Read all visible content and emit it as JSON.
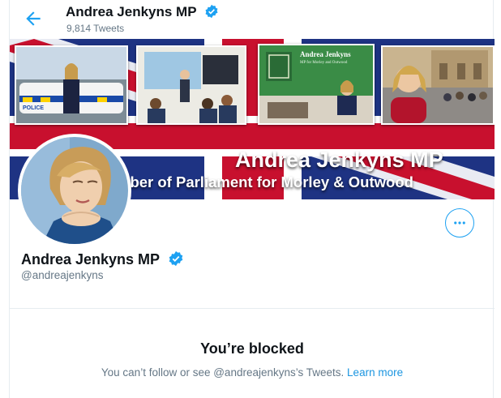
{
  "header": {
    "name": "Andrea Jenkyns MP",
    "tweet_count": "9,814 Tweets",
    "back_icon": "arrow-left-icon"
  },
  "banner": {
    "title": "Andrea Jenkyns MP",
    "subtitle": "mber of Parliament for Morley & Outwood",
    "sign_title": "Andrea Jenkyns",
    "sign_subtitle": "MP for Morley and Outwood",
    "vehicle_label": "POLICE"
  },
  "profile": {
    "name": "Andrea Jenkyns MP",
    "handle": "@andreajenkyns",
    "verified_icon": "verified-badge-icon",
    "more_icon": "more-options-icon"
  },
  "blocked": {
    "title": "You’re blocked",
    "message": "You can’t follow or see @andreajenkyns’s Tweets.",
    "learn_more": "Learn more"
  },
  "colors": {
    "accent": "#1da1f2",
    "text": "#0f1419",
    "secondary": "#657786",
    "border": "#e6ecf0",
    "banner_blue": "#1b2f79",
    "banner_red": "#c8102e"
  }
}
